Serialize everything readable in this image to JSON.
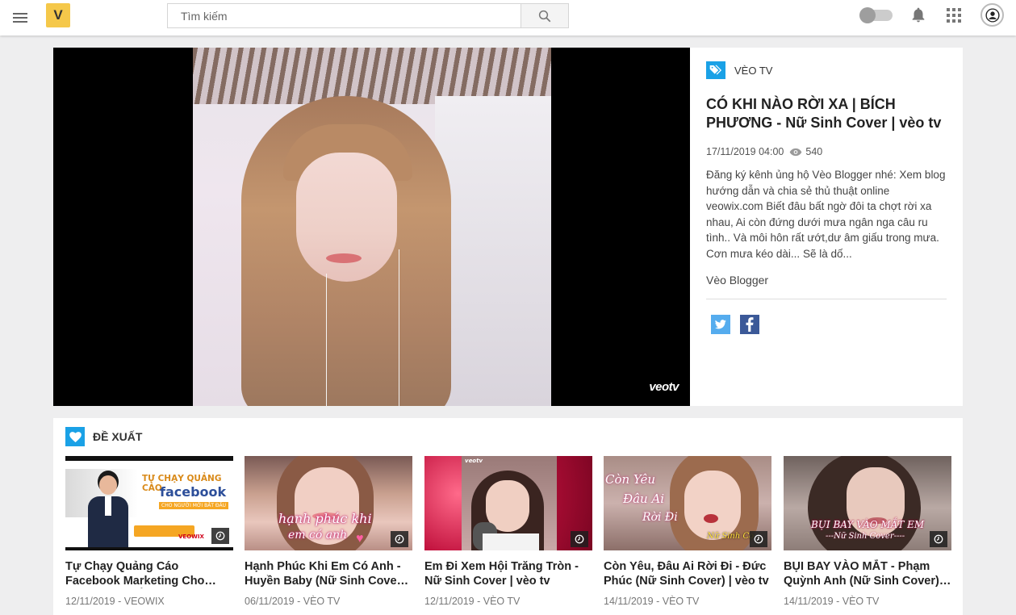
{
  "header": {
    "logo_text": "V",
    "search_placeholder": "Tìm kiếm",
    "icons": [
      "menu-icon",
      "search-icon",
      "dark-mode-toggle",
      "bell-icon",
      "apps-grid-icon",
      "account-icon"
    ]
  },
  "featured": {
    "watermark": "veotv",
    "channel": "VÈO TV",
    "title": "CÓ KHI NÀO RỜI XA | BÍCH PHƯƠNG - Nữ Sinh Cover | vèo tv",
    "date": "17/11/2019 04:00",
    "views": "540",
    "description": "Đăng ký kênh ủng hộ Vèo Blogger nhé: Xem blog hướng dẫn và chia sẻ thủ thuật online veowix.com Biết đâu bất ngờ đôi ta chợt rời xa nhau, Ai còn đứng dưới mưa ngân nga câu ru tình.. Và môi hôn rất ướt,dư âm giấu trong mưa. Cơn mưa kéo dài... Sẽ là dố...",
    "author": "Vèo Blogger",
    "share": [
      "twitter-icon",
      "facebook-icon"
    ]
  },
  "recommend": {
    "heading": "ĐỀ XUẤT",
    "items": [
      {
        "title": "Tự Chạy Quảng Cáo Facebook Marketing Cho Người Mới Bắt Đầu",
        "date": "12/11/2019",
        "channel": "VEOWIX",
        "thumb_lines": [
          "TỰ CHẠY QUẢNG CÁO",
          "facebook",
          "CHO NGƯỜI MỚI BẮT ĐẦU"
        ],
        "thumb_logo": "VEOWIX"
      },
      {
        "title": "Hạnh Phúc Khi Em Có Anh - Huyền Baby (Nữ Sinh Cover) | vèo tv",
        "date": "06/11/2019",
        "channel": "VÈO TV",
        "thumb_lines": [
          "hạnh phúc khi",
          "em có anh"
        ]
      },
      {
        "title": "Em Đi Xem Hội Trăng Tròn - Nữ Sinh Cover | vèo tv",
        "date": "12/11/2019",
        "channel": "VÈO TV",
        "thumb_lines": [
          "veotv"
        ]
      },
      {
        "title": "Còn Yêu, Đâu Ai Rời Đi - Đức Phúc (Nữ Sinh Cover) | vèo tv",
        "date": "14/11/2019",
        "channel": "VÈO TV",
        "thumb_lines": [
          "Còn Yêu",
          "Đâu Ai",
          "Rời Đi",
          "Nữ Sinh Co"
        ]
      },
      {
        "title": "BỤI BAY VÀO MẮT - Phạm Quỳnh Anh (Nữ Sinh Cover) | vèo tv",
        "date": "14/11/2019",
        "channel": "VÈO TV",
        "thumb_lines": [
          "BỤI BAY VÀO MẮT EM",
          "---Nữ Sinh Cover----"
        ]
      }
    ]
  }
}
